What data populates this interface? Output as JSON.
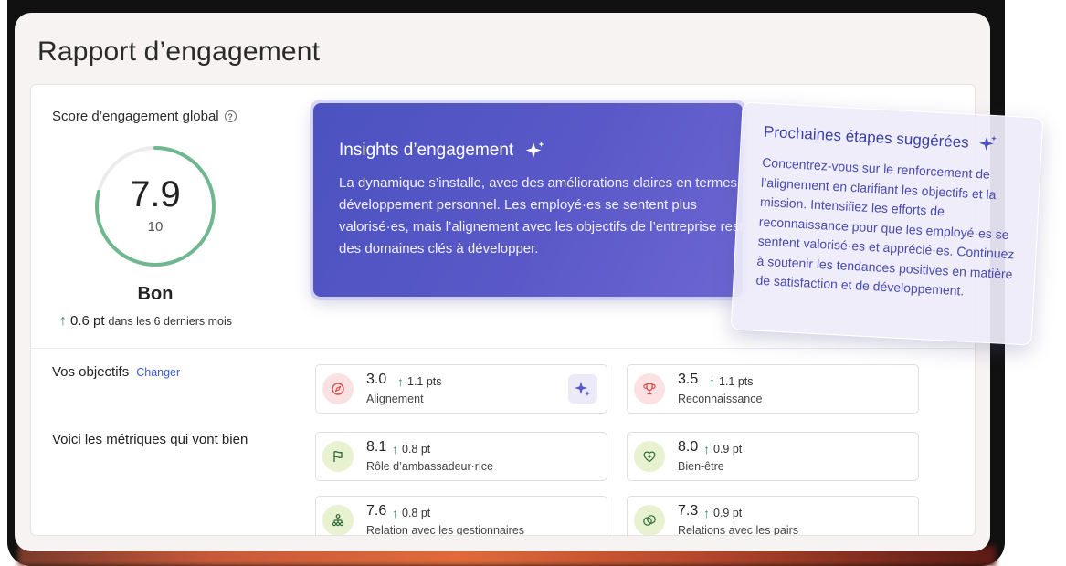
{
  "page": {
    "title": "Rapport d’engagement"
  },
  "score": {
    "title": "Score d’engagement global",
    "value": "7.9",
    "max": "10",
    "fraction": 0.79,
    "label": "Bon",
    "delta": "0.6 pt",
    "period": "dans les 6 derniers mois"
  },
  "objectives": {
    "title": "Vos objectifs",
    "change_label": "Changer",
    "items": [
      {
        "value": "3.0",
        "delta": "1.1 pts",
        "name": "Alignement",
        "icon": "compass-icon"
      },
      {
        "value": "3.5",
        "delta": "1.1 pts",
        "name": "Reconnaissance",
        "icon": "trophy-icon"
      }
    ]
  },
  "metrics": {
    "title": "Voici les métriques qui vont bien",
    "items": [
      {
        "value": "8.1",
        "delta": "0.8 pt",
        "name": "Rôle d’ambassadeur·rice",
        "icon": "flag-icon"
      },
      {
        "value": "8.0",
        "delta": "0.9 pt",
        "name": "Bien-être",
        "icon": "heart-plus-icon"
      },
      {
        "value": "7.6",
        "delta": "0.8 pt",
        "name": "Relation avec les gestionnaires",
        "icon": "org-chart-icon"
      },
      {
        "value": "7.3",
        "delta": "0.9 pt",
        "name": "Relations avec les pairs",
        "icon": "peers-icon"
      }
    ]
  },
  "insights": {
    "title": "Insights d’engagement",
    "body": "La dynamique s’installe, avec des améliorations claires en termes de développement personnel. Les employé·es se sentent plus valorisé·es, mais l’alignement avec les objectifs de l’entreprise restent des domaines clés à développer."
  },
  "next_steps": {
    "title": "Prochaines étapes suggérées",
    "body": "Concentrez-vous sur le renforcement de l’alignement en clarifiant les objectifs et la mission. Intensifiez les efforts de reconnaissance pour que les employé·es se sentent valorisé·es et apprécié·es. Continuez à soutenir les tendances positives en matière de satisfaction et de développement."
  },
  "colors": {
    "ring": "#6fb88f",
    "accent": "#4b52c0",
    "positive": "#2f8a5c"
  }
}
